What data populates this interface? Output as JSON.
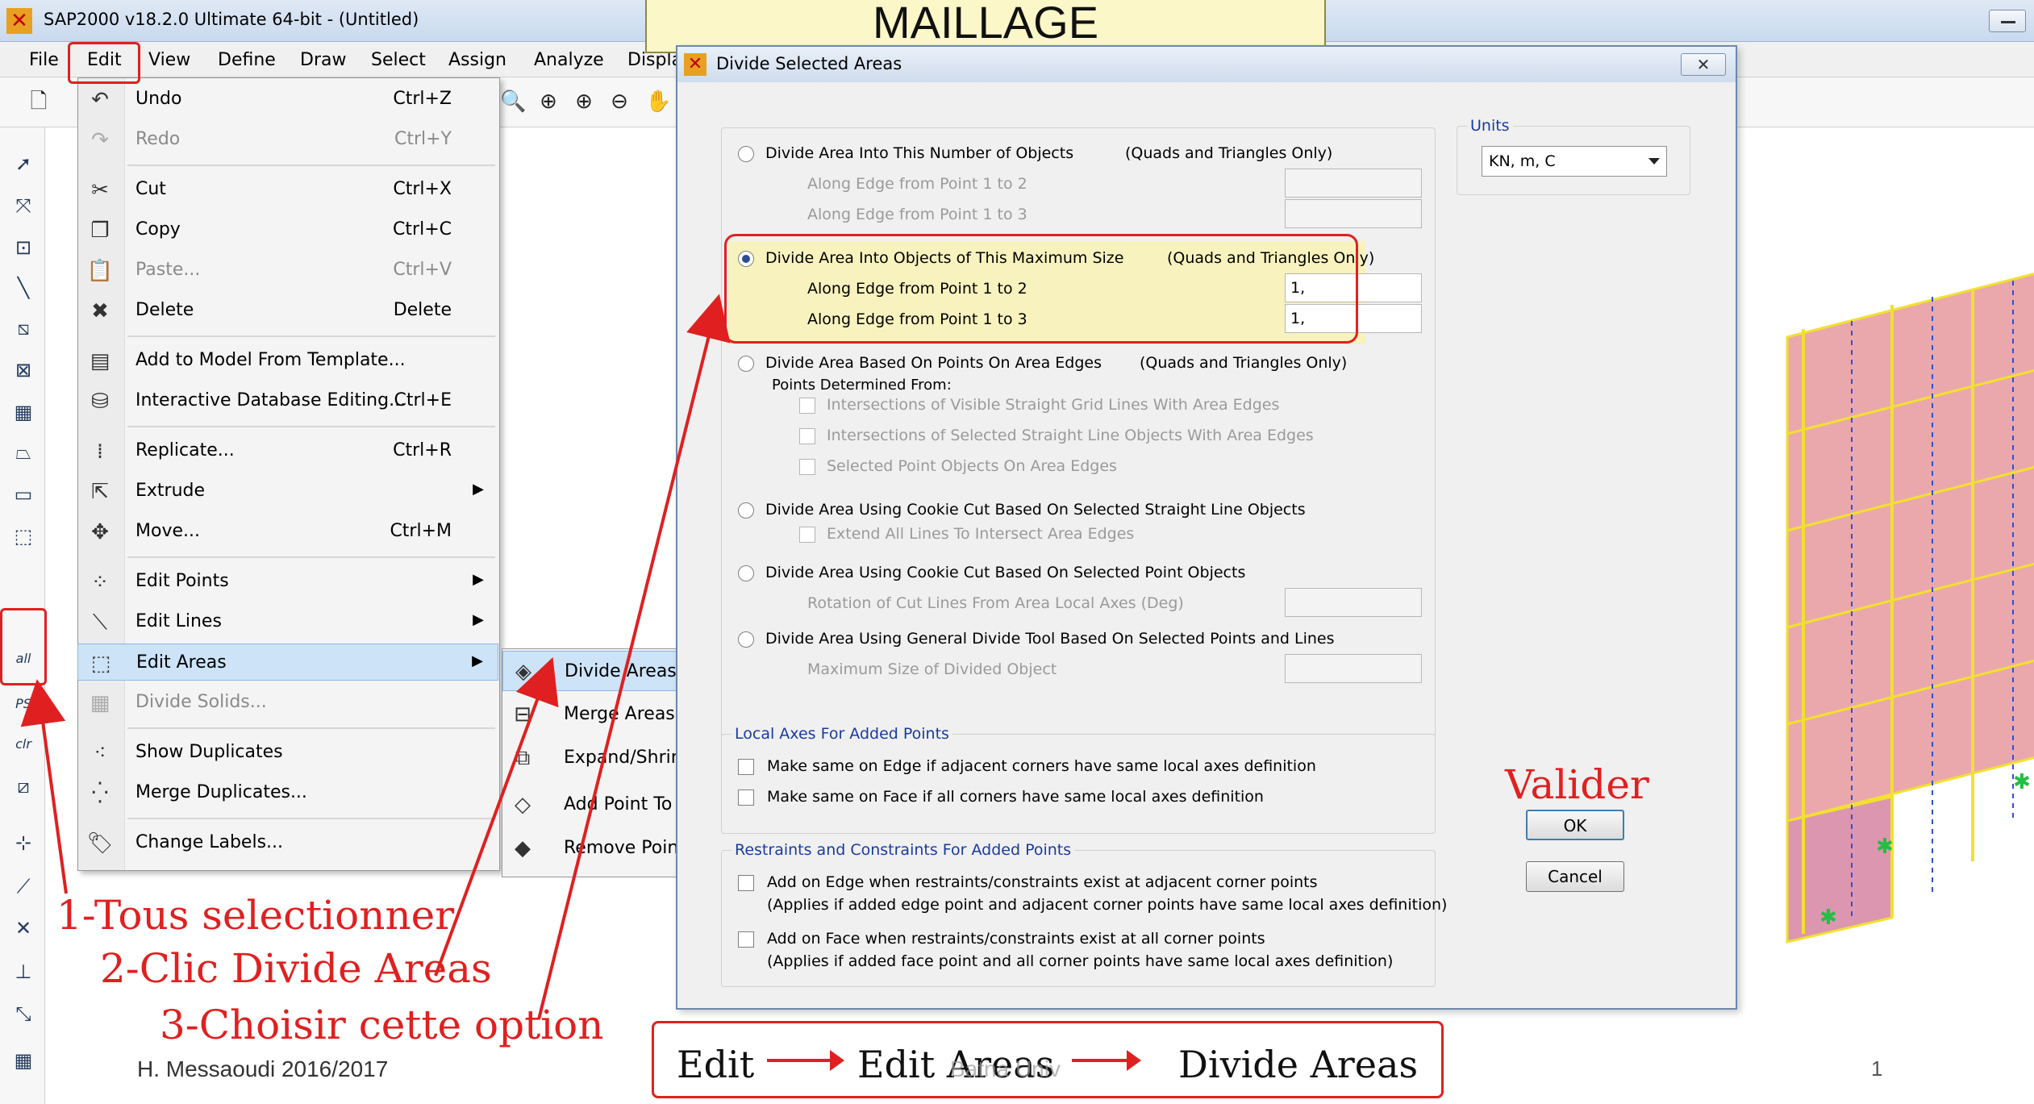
{
  "app": {
    "title": "SAP2000 v18.2.0 Ultimate 64-bit - (Untitled)"
  },
  "menubar": {
    "items": [
      "File",
      "Edit",
      "View",
      "Define",
      "Draw",
      "Select",
      "Assign",
      "Analyze",
      "Displa"
    ]
  },
  "left_toolbar": {
    "all_label": "all",
    "ps_label": "PS",
    "clr_label": "clr"
  },
  "edit_menu": {
    "items": [
      {
        "label": "Undo",
        "shortcut": "Ctrl+Z",
        "icon": "undo-icon",
        "disabled": false
      },
      {
        "label": "Redo",
        "shortcut": "Ctrl+Y",
        "icon": "redo-icon",
        "disabled": true
      },
      {
        "label": "Cut",
        "shortcut": "Ctrl+X",
        "icon": "scissors-icon",
        "disabled": false
      },
      {
        "label": "Copy",
        "shortcut": "Ctrl+C",
        "icon": "copy-icon",
        "disabled": false
      },
      {
        "label": "Paste...",
        "shortcut": "Ctrl+V",
        "icon": "paste-icon",
        "disabled": true
      },
      {
        "label": "Delete",
        "shortcut": "Delete",
        "icon": "delete-icon",
        "disabled": false
      },
      {
        "label": "Add to Model From Template...",
        "shortcut": "",
        "icon": "template-icon",
        "disabled": false
      },
      {
        "label": "Interactive Database Editing...",
        "shortcut": "Ctrl+E",
        "icon": "database-icon",
        "disabled": false
      },
      {
        "label": "Replicate...",
        "shortcut": "Ctrl+R",
        "icon": "replicate-icon",
        "disabled": false
      },
      {
        "label": "Extrude",
        "shortcut": "",
        "icon": "extrude-icon",
        "disabled": false
      },
      {
        "label": "Move...",
        "shortcut": "Ctrl+M",
        "icon": "move-icon",
        "disabled": false
      },
      {
        "label": "Edit Points",
        "shortcut": "",
        "icon": "edit-points-icon",
        "disabled": false
      },
      {
        "label": "Edit Lines",
        "shortcut": "",
        "icon": "edit-lines-icon",
        "disabled": false
      },
      {
        "label": "Edit Areas",
        "shortcut": "",
        "icon": "edit-areas-icon",
        "disabled": false
      },
      {
        "label": "Divide Solids...",
        "shortcut": "",
        "icon": "divide-solids-icon",
        "disabled": true
      },
      {
        "label": "Show Duplicates",
        "shortcut": "",
        "icon": "show-duplicates-icon",
        "disabled": false
      },
      {
        "label": "Merge Duplicates...",
        "shortcut": "",
        "icon": "merge-duplicates-icon",
        "disabled": false
      },
      {
        "label": "Change Labels...",
        "shortcut": "",
        "icon": "change-labels-icon",
        "disabled": false
      }
    ]
  },
  "submenu": {
    "items": [
      {
        "label": "Divide Areas...",
        "icon": "divide-areas-icon"
      },
      {
        "label": "Merge Areas",
        "icon": "merge-areas-icon"
      },
      {
        "label": "Expand/Shrink",
        "icon": "expand-shrink-icon"
      },
      {
        "label": "Add Point To",
        "icon": "add-point-icon"
      },
      {
        "label": "Remove Point",
        "icon": "remove-point-icon"
      }
    ]
  },
  "dialog": {
    "title": "Divide Selected Areas",
    "close_label": "✕",
    "options": {
      "opt1": {
        "label": "Divide Area Into This Number of Objects",
        "note": "(Quads and Triangles Only)",
        "edge12": "Along Edge from Point 1 to 2",
        "edge13": "Along Edge from Point 1 to 3",
        "value12": "",
        "value13": ""
      },
      "opt2": {
        "label": "Divide Area Into Objects of This Maximum Size",
        "note": "(Quads and Triangles Only)",
        "edge12": "Along Edge from Point 1 to 2",
        "edge13": "Along Edge from Point 1 to 3",
        "value12": "1,",
        "value13": "1,"
      },
      "opt3": {
        "label": "Divide Area Based On Points On Area Edges",
        "note": "(Quads and Triangles Only)",
        "sub": "Points Determined From:",
        "c1": "Intersections of Visible Straight Grid Lines With Area Edges",
        "c2": "Intersections of Selected Straight Line Objects With Area Edges",
        "c3": "Selected Point Objects On Area Edges"
      },
      "opt4": {
        "label": "Divide Area Using Cookie Cut Based On Selected Straight Line Objects",
        "c1": "Extend All Lines To Intersect Area Edges"
      },
      "opt5": {
        "label": "Divide Area Using Cookie Cut Based On Selected Point Objects",
        "sub": "Rotation of Cut Lines From Area Local Axes (Deg)"
      },
      "opt6": {
        "label": "Divide Area Using General Divide Tool Based On Selected Points and Lines",
        "sub": "Maximum Size of Divided Object"
      }
    },
    "units": {
      "title": "Units",
      "value": "KN, m, C"
    },
    "local_axes": {
      "title": "Local Axes For Added Points",
      "c1": "Make same on Edge if adjacent corners have same local axes definition",
      "c2": "Make same on Face if all corners have same local axes definition"
    },
    "restraints": {
      "title": "Restraints and Constraints For Added Points",
      "c1": "Add on Edge when restraints/constraints exist at adjacent corner points",
      "c1_note": "(Applies if added edge point and adjacent corner points have same local axes definition)",
      "c2": "Add on Face when restraints/constraints exist at all corner points",
      "c2_note": "(Applies if added face point and all corner points have same local axes definition)"
    },
    "ok_label": "OK",
    "cancel_label": "Cancel"
  },
  "annotations": {
    "heading": "MAILLAGE",
    "valider": "Valider",
    "step1": "1-Tous selectionner",
    "step2": "2-Clic Divide Areas",
    "step3": "3-Choisir cette option",
    "path": [
      "Edit",
      "Edit Areas",
      "Divide Areas"
    ],
    "author": "H. Messaoudi 2016/2017",
    "watermark": "Batna Univ",
    "page_number": "1",
    "color": "#e02020"
  }
}
